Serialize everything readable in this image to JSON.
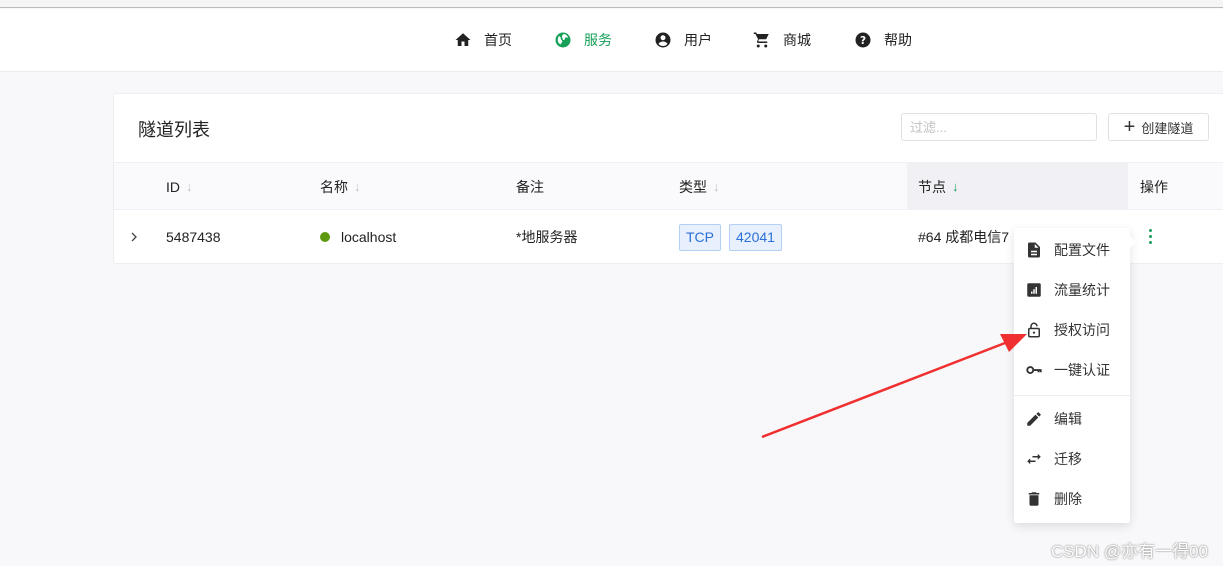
{
  "nav": {
    "items": [
      {
        "label": "首页",
        "icon": "home-icon"
      },
      {
        "label": "服务",
        "icon": "globe-icon",
        "active": true
      },
      {
        "label": "用户",
        "icon": "account-circle-icon"
      },
      {
        "label": "商城",
        "icon": "cart-icon"
      },
      {
        "label": "帮助",
        "icon": "help-circle-icon"
      }
    ]
  },
  "card": {
    "title": "隧道列表",
    "filter_placeholder": "过滤...",
    "create_label": "创建隧道"
  },
  "table": {
    "headers": {
      "id": "ID",
      "name": "名称",
      "note": "备注",
      "type": "类型",
      "node": "节点",
      "actions": "操作"
    },
    "sort_arrow": "↓",
    "rows": [
      {
        "id": "5487438",
        "name": "localhost",
        "status_color": "#5f9a0e",
        "note": "*地服务器",
        "protocol": "TCP",
        "port": "42041",
        "node": "#64 成都电信7"
      }
    ]
  },
  "menu": {
    "items": [
      "配置文件",
      "流量统计",
      "授权访问",
      "一键认证",
      "编辑",
      "迁移",
      "删除"
    ]
  },
  "watermark": "CSDN @亦有一得00",
  "colors": {
    "accent": "#18a058",
    "annotation_arrow": "#f03030"
  }
}
